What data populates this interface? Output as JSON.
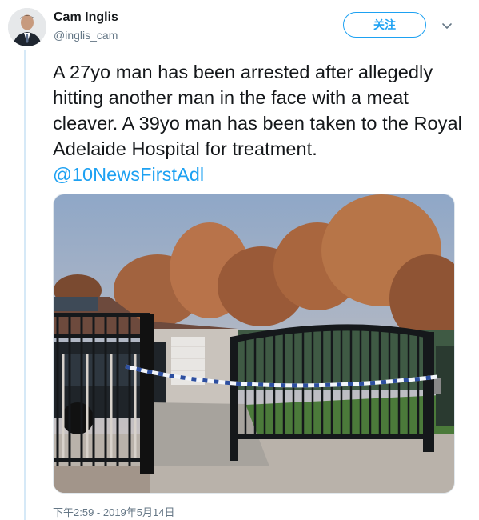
{
  "author": {
    "name": "Cam Inglis",
    "handle": "@inglis_cam"
  },
  "follow_label": "关注",
  "icons": {
    "avatar": "profile-photo",
    "menu": "chevron-down-icon"
  },
  "tweet": {
    "text": "A 27yo man has been arrested after allegedly hitting another man in the face with a meat cleaver. A 39yo man has been taken to the Royal Adelaide Hospital for treatment.",
    "mention": "@10NewsFirstAdl"
  },
  "timestamp": "下午2:59 - 2019年5月14日",
  "colors": {
    "accent": "#1da1f2",
    "text": "#14171a",
    "muted": "#657786"
  }
}
